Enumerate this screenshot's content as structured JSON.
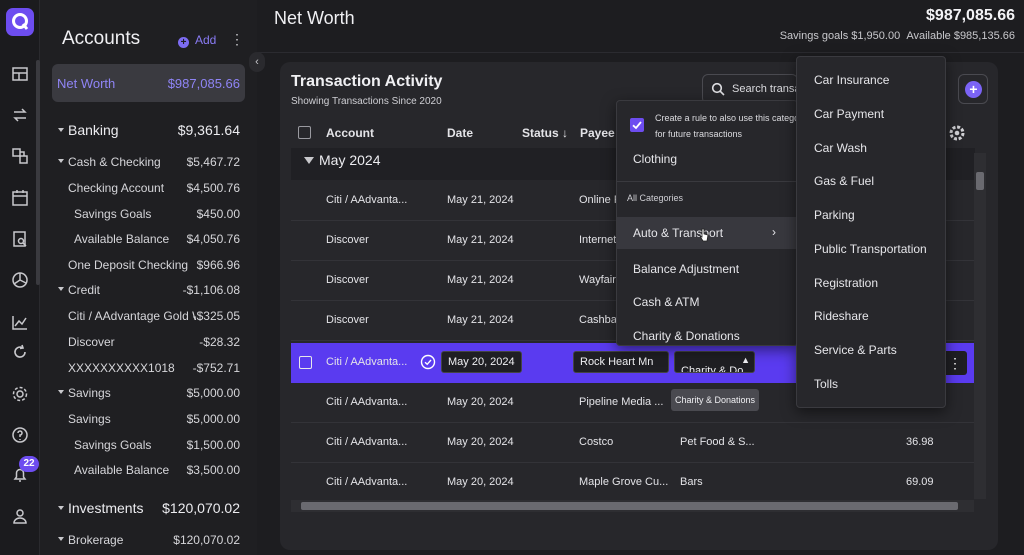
{
  "rail": {
    "notif_count": "22"
  },
  "accounts": {
    "title": "Accounts",
    "add_label": "Add",
    "net_worth": {
      "label": "Net Worth",
      "value": "$987,085.66"
    },
    "rows": [
      {
        "label": "Banking",
        "value": "$9,361.64"
      },
      {
        "label": "Cash & Checking",
        "value": "$5,467.72"
      },
      {
        "label": "Checking Account",
        "value": "$4,500.76"
      },
      {
        "label": "Savings Goals",
        "value": "$450.00"
      },
      {
        "label": "Available Balance",
        "value": "$4,050.76"
      },
      {
        "label": "One Deposit Checking",
        "value": "$966.96"
      },
      {
        "label": "Credit",
        "value": "-$1,106.08"
      },
      {
        "label": "Citi / AAdvantage Gold W...",
        "value": "-$325.05"
      },
      {
        "label": "Discover",
        "value": "-$28.32"
      },
      {
        "label": "XXXXXXXXXX1018",
        "value": "-$752.71"
      },
      {
        "label": "Savings",
        "value": "$5,000.00"
      },
      {
        "label": "Savings",
        "value": "$5,000.00"
      },
      {
        "label": "Savings Goals",
        "value": "$1,500.00"
      },
      {
        "label": "Available Balance",
        "value": "$3,500.00"
      },
      {
        "label": "Investments",
        "value": "$120,070.02"
      },
      {
        "label": "Brokerage",
        "value": "$120,070.02"
      }
    ]
  },
  "header": {
    "title": "Net Worth",
    "total": "$987,085.66",
    "savings_goals": "Savings goals $1,950.00",
    "available": "Available $985,135.66"
  },
  "transactions": {
    "title": "Transaction Activity",
    "subtitle": "Showing Transactions Since 2020",
    "search_placeholder": "Search transa",
    "columns": {
      "account": "Account",
      "date": "Date",
      "status": "Status",
      "payee": "Payee"
    },
    "month": "May 2024",
    "rows": [
      {
        "account": "Citi / AAdvantа...",
        "date": "May 21, 2024",
        "payee": "Online F",
        "category": "",
        "amount": ""
      },
      {
        "account": "Discover",
        "date": "May 21, 2024",
        "payee": "Internet",
        "category": "",
        "amount": ""
      },
      {
        "account": "Discover",
        "date": "May 21, 2024",
        "payee": "Wayfair",
        "category": "",
        "amount": ""
      },
      {
        "account": "Discover",
        "date": "May 21, 2024",
        "payee": "Cashbac",
        "category": "",
        "amount": ""
      },
      {
        "account": "Citi / AAdvanta...",
        "date": "May 20, 2024",
        "payee": "Rock Heart Mn",
        "category": "Charity & Do",
        "amount": ""
      },
      {
        "account": "Citi / AAdvanta...",
        "date": "May 20, 2024",
        "payee": "Pipeline Media ...",
        "category": "",
        "amount": ""
      },
      {
        "account": "Citi / AAdvanta...",
        "date": "May 20, 2024",
        "payee": "Costco",
        "category": "Pet Food & S...",
        "amount": "36.98"
      },
      {
        "account": "Citi / AAdvanta...",
        "date": "May 20, 2024",
        "payee": "Maple Grove Cu...",
        "category": "Bars",
        "amount": "69.09"
      }
    ],
    "tooltip": "Charity & Donations"
  },
  "category_menu": {
    "rule_text_1": "Create a rule to also use this catego",
    "rule_text_2": "for future transactions",
    "current": "Clothing",
    "section": "All Categories",
    "items": [
      "Auto & Transport",
      "Balance Adjustment",
      "Cash & ATM",
      "Charity & Donations"
    ]
  },
  "sub_menu": {
    "items": [
      "Car Insurance",
      "Car Payment",
      "Car Wash",
      "Gas & Fuel",
      "Parking",
      "Public Transportation",
      "Registration",
      "Rideshare",
      "Service & Parts",
      "Tolls"
    ]
  }
}
